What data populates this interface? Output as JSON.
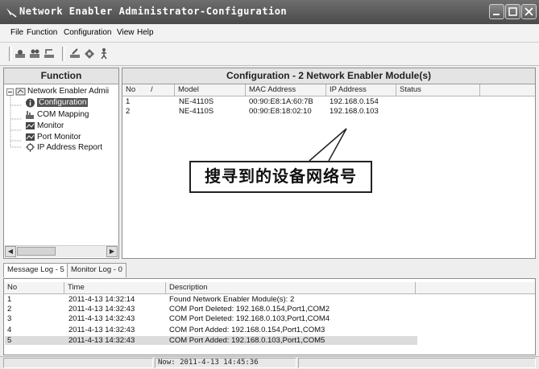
{
  "window": {
    "title": "Network Enabler Administrator-Configuration"
  },
  "menu": [
    {
      "label": "File"
    },
    {
      "label": "Function"
    },
    {
      "label": "Configuration"
    },
    {
      "label": "View"
    },
    {
      "label": "Help"
    }
  ],
  "toolbar": {
    "icons": [
      "search-icon",
      "search-all-icon",
      "network-icon",
      "settings-icon",
      "tools-icon",
      "exit-icon"
    ]
  },
  "function_pane": {
    "title": "Function",
    "tree": [
      {
        "label": "Network Enabler Admii"
      },
      {
        "label": "Configuration"
      },
      {
        "label": "COM Mapping"
      },
      {
        "label": "Monitor"
      },
      {
        "label": "Port Monitor"
      },
      {
        "label": "IP Address Report"
      }
    ]
  },
  "config_pane": {
    "title": "Configuration - 2 Network Enabler Module(s)",
    "columns": [
      "No",
      "/",
      "Model",
      "MAC Address",
      "IP Address",
      "Status"
    ],
    "rows": [
      {
        "no": "1",
        "model": "NE-4110S",
        "mac": "00:90:E8:1A:60:7B",
        "ip": "192.168.0.154",
        "status": ""
      },
      {
        "no": "2",
        "model": "NE-4110S",
        "mac": "00:90:E8:18:02:10",
        "ip": "192.168.0.103",
        "status": ""
      }
    ]
  },
  "annotation": {
    "text": "搜寻到的设备网络号"
  },
  "log_tabs": [
    {
      "label": "Message Log - 5"
    },
    {
      "label": "Monitor Log - 0"
    }
  ],
  "log": {
    "columns": [
      "No",
      "Time",
      "Description"
    ],
    "rows": [
      {
        "no": "1",
        "time": "2011-4-13 14:32:14",
        "desc": "Found Network Enabler Module(s): 2"
      },
      {
        "no": "2",
        "time": "2011-4-13 14:32:43",
        "desc": "COM Port Deleted: 192.168.0.154,Port1,COM2"
      },
      {
        "no": "3",
        "time": "2011-4-13 14:32:43",
        "desc": "COM Port Deleted: 192.168.0.103,Port1,COM4"
      },
      {
        "no": "4",
        "time": "2011-4-13 14:32:43",
        "desc": "COM Port Added: 192.168.0.154,Port1,COM3"
      },
      {
        "no": "5",
        "time": "2011-4-13 14:32:43",
        "desc": "COM Port Added: 192.168.0.103,Port1,COM5"
      }
    ]
  },
  "status": {
    "text": "Now: 2011-4-13 14:45:36"
  }
}
